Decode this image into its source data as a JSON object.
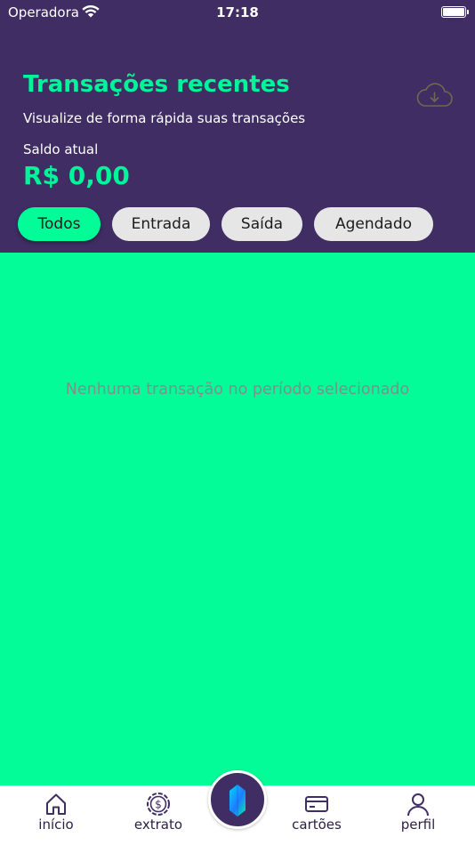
{
  "status_bar": {
    "carrier": "Operadora",
    "time": "17:18"
  },
  "header": {
    "title": "Transações recentes",
    "subtitle": "Visualize de forma rápida suas transações",
    "balance_label": "Saldo atual",
    "balance_value": "R$ 0,00",
    "download_icon": "cloud-download-icon"
  },
  "filters": [
    {
      "label": "Todos",
      "active": true
    },
    {
      "label": "Entrada",
      "active": false
    },
    {
      "label": "Saída",
      "active": false
    },
    {
      "label": "Agendado",
      "active": false
    }
  ],
  "empty_state": "Nenhuma transação no período selecionado",
  "tabbar": {
    "items": [
      {
        "label": "início",
        "icon": "home-icon"
      },
      {
        "label": "extrato",
        "icon": "dollar-coin-icon"
      },
      {
        "label": "cartões",
        "icon": "card-icon"
      },
      {
        "label": "perfil",
        "icon": "user-icon"
      }
    ],
    "center_icon": "gem-icon"
  },
  "colors": {
    "header_bg": "#3F2D63",
    "accent": "#00F59A",
    "content_bg": "#03FC98"
  }
}
